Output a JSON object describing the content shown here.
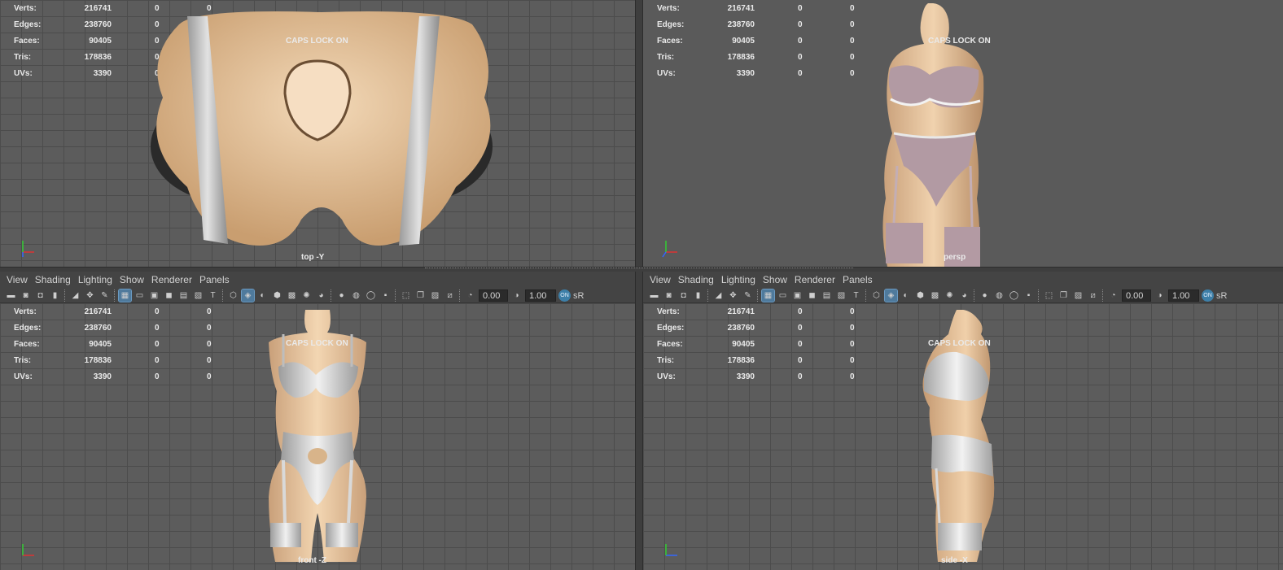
{
  "menus": {
    "left": [
      "View",
      "Shading",
      "Lighting",
      "Show",
      "Renderer",
      "Panels"
    ],
    "right": [
      "View",
      "Shading",
      "Lighting",
      "Show",
      "Renderer",
      "Panels"
    ]
  },
  "toolbar": {
    "exposure_value": "0.00",
    "gamma_value": "1.00",
    "colorspace_label": "sR",
    "colorspace_badge": "ON"
  },
  "hud": {
    "labels": [
      "Verts:",
      "Edges:",
      "Faces:",
      "Tris:",
      "UVs:"
    ],
    "values": [
      "216741",
      "238760",
      "90405",
      "178836",
      "3390"
    ],
    "zero": "0"
  },
  "caps_text": "CAPS LOCK ON",
  "viewports": {
    "top_label": "top -Y",
    "persp_label": "persp",
    "front_label": "front -Z",
    "side_label": "side -X"
  },
  "axis": {
    "x": "x",
    "y": "y",
    "z": "z"
  },
  "colors": {
    "viewport_bg": "#5c5c5c",
    "skin": "#e7c39a",
    "satin": "#cfcfcf",
    "lace": "#b39aa3",
    "highlight": "#4f7a9c"
  }
}
